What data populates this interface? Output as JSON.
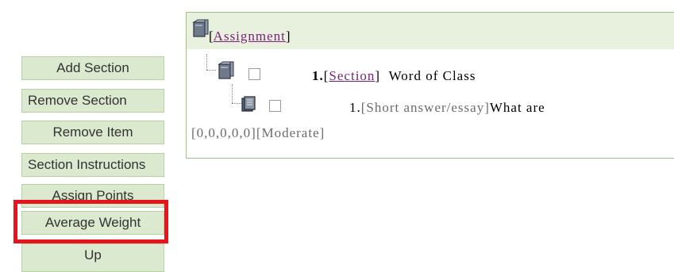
{
  "sidebar": {
    "buttons": [
      {
        "label": "Add Section"
      },
      {
        "label": "Remove Section"
      },
      {
        "label": "Remove Item"
      },
      {
        "label": "Section Instructions"
      },
      {
        "label": "Assign Points"
      },
      {
        "label": "Average Weight"
      },
      {
        "label": "Up"
      }
    ],
    "highlighted": "Average Weight",
    "highlight_color": "#e8141b"
  },
  "tree": {
    "root": {
      "icon": "folder-icon",
      "prefix": "[",
      "label": "Assignment",
      "suffix": "]"
    },
    "section": {
      "icon": "folder-icon",
      "number": "1.",
      "type_label": "Section",
      "title": "Word of Class"
    },
    "item": {
      "icon": "document-icon",
      "number": "1.",
      "type_label": "[Short answer/essay]",
      "text": "What are",
      "meta": "[0,0,0,0,0][Moderate]"
    }
  },
  "colors": {
    "button_bg": "#dbe9cf",
    "panel_border": "#a4c08a",
    "link": "#7b1f7b"
  }
}
